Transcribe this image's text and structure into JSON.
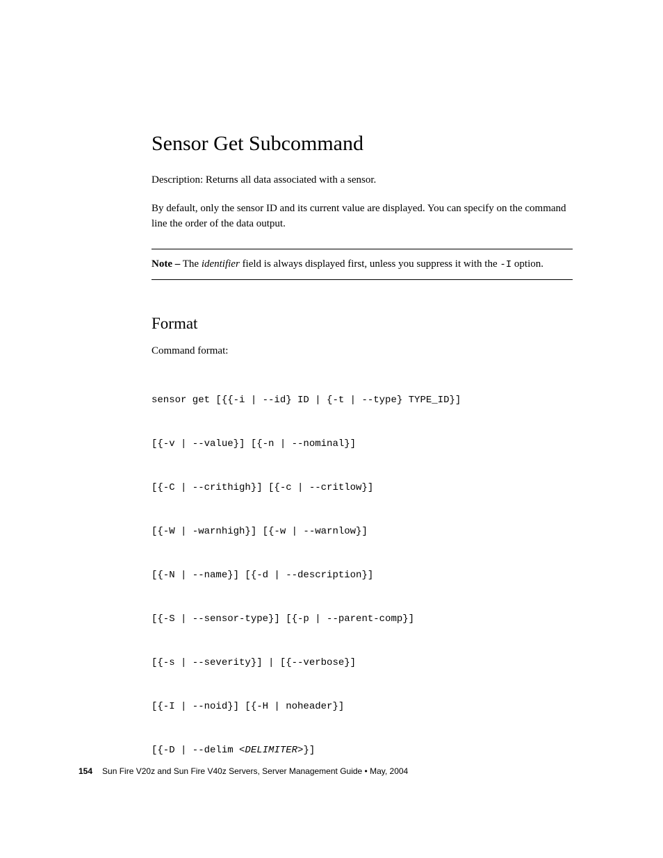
{
  "heading": "Sensor Get Subcommand",
  "description": "Description: Returns all data associated with a sensor.",
  "bodyText": "By default, only the sensor ID and its current value are displayed. You can specify on the command line the order of the data output.",
  "note": {
    "label": "Note –",
    "textBefore": " The ",
    "identifier": "identifier",
    "textMiddle": " field is always displayed first, unless you suppress it with the ",
    "option": "-I",
    "textAfter": " option."
  },
  "formatHeading": "Format",
  "commandLabel": "Command format:",
  "codeLines": [
    "sensor get [{{-i | --id} ID | {-t | --type} TYPE_ID}]",
    "[{-v | --value}] [{-n | --nominal}]",
    "[{-C | --crithigh}] [{-c | --critlow}]",
    "[{-W | -warnhigh}] [{-w | --warnlow}]",
    "[{-N | --name}] [{-d | --description}]",
    "[{-S | --sensor-type}] [{-p | --parent-comp}]",
    "[{-s | --severity}] | [{--verbose}]",
    "[{-I | --noid}] [{-H | noheader}]"
  ],
  "lastCodeLine": {
    "prefix": "[{-D | --delim ",
    "delimiter": "<DELIMITER>",
    "suffix": "}]"
  },
  "footer": {
    "pageNumber": "154",
    "text": "Sun Fire V20z and Sun Fire V40z Servers, Server Management Guide • May, 2004"
  }
}
